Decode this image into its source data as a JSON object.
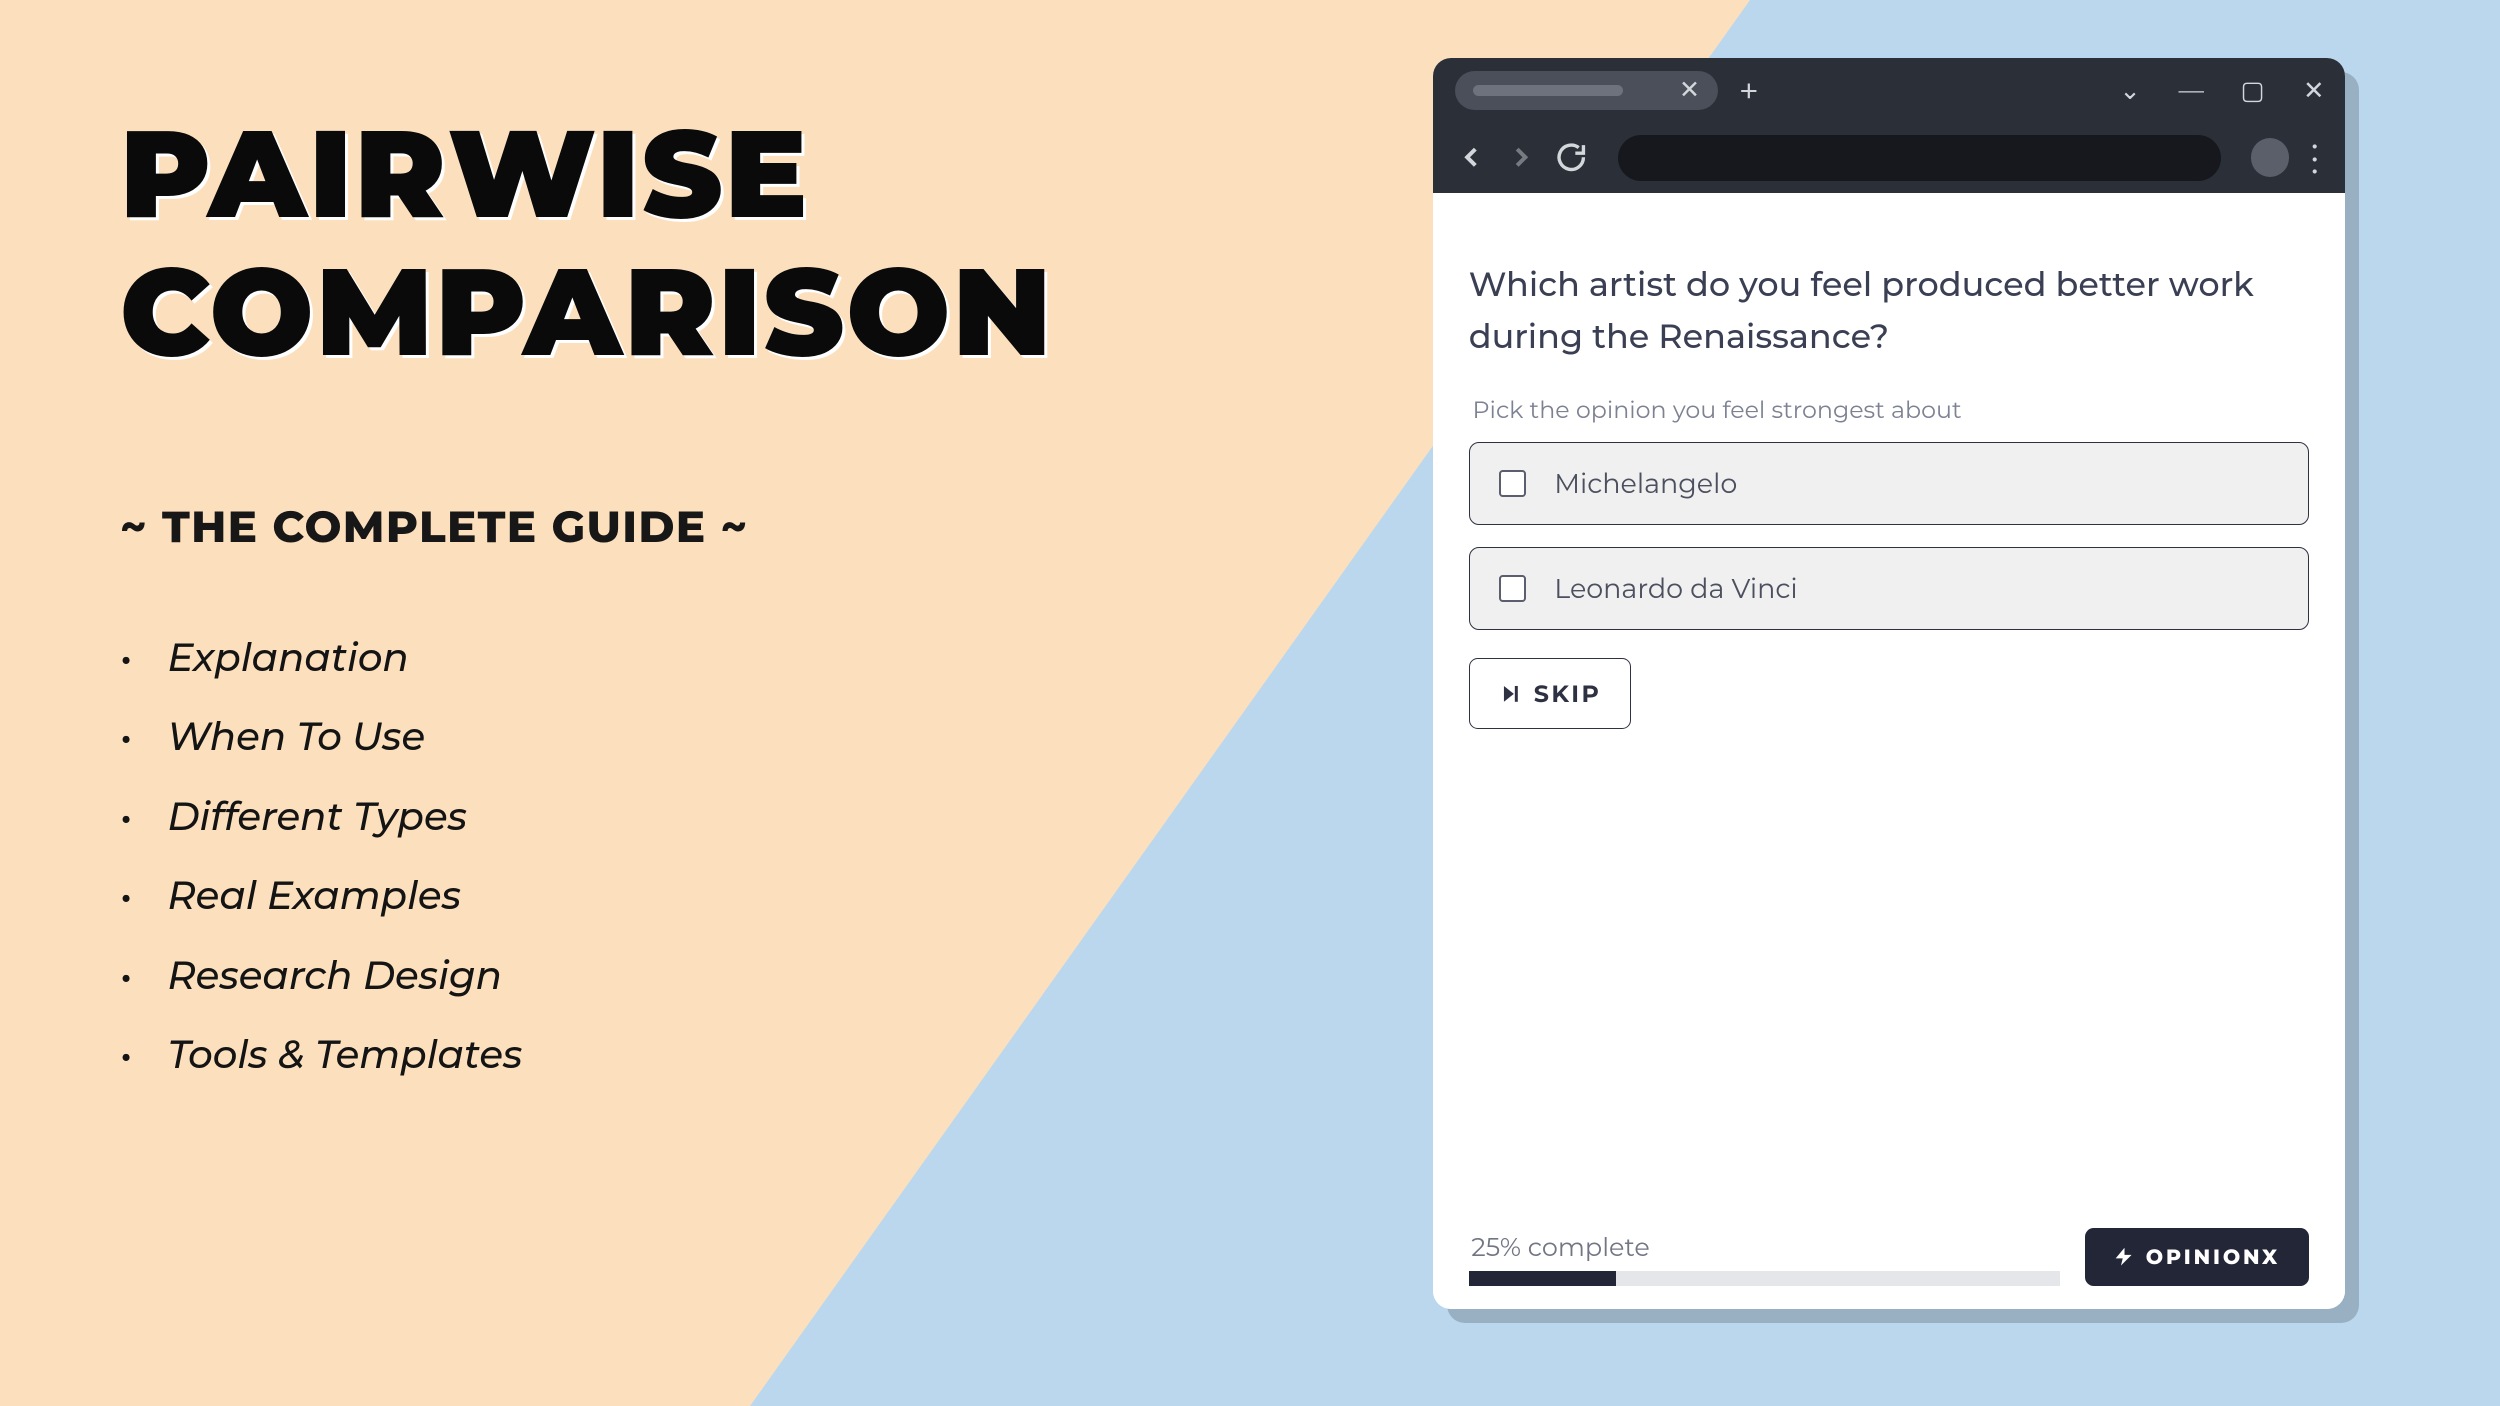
{
  "hero": {
    "title_line1": "PAIRWISE",
    "title_line2": "COMPARISON",
    "subtitle": "~ THE COMPLETE GUIDE ~",
    "bullets": [
      "Explanation",
      "When To Use",
      "Different Types",
      "Real Examples",
      "Research Design",
      "Tools & Templates"
    ]
  },
  "survey": {
    "question": "Which artist do you feel produced better work during the Renaissance?",
    "instruction": "Pick the opinion you feel strongest about",
    "options": [
      "Michelangelo",
      "Leonardo da Vinci"
    ],
    "skip_label": "SKIP",
    "progress": {
      "label": "25% complete",
      "percent": 25
    },
    "brand": "OPINIONX"
  }
}
